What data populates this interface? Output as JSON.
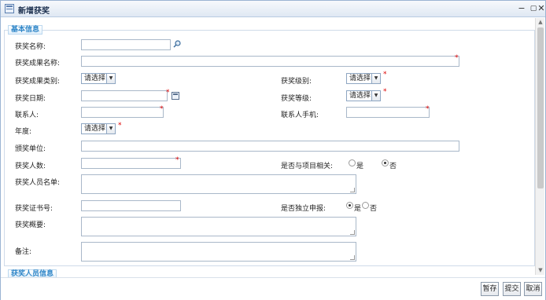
{
  "window": {
    "title": "新增获奖"
  },
  "sections": {
    "basic": "基本信息",
    "people": "获奖人员信息"
  },
  "form": {
    "award_name": "获奖名称:",
    "result_name": "获奖成果名称:",
    "result_category": "获奖成果类别:",
    "award_level": "获奖级别:",
    "award_date": "获奖日期:",
    "award_grade": "获奖等级:",
    "contact": "联系人:",
    "contact_phone": "联系人手机:",
    "year": "年度:",
    "issuer": "颁奖单位:",
    "award_count": "获奖人数:",
    "project_related": "是否与项目相关:",
    "member_list": "获奖人员名单:",
    "certificate_no": "获奖证书号:",
    "independent": "是否独立申报:",
    "summary": "获奖概要:",
    "remarks": "备注:",
    "select_placeholder": "请选择",
    "yes": "是",
    "no": "否"
  },
  "buttons": {
    "save_draft": "暂存",
    "submit": "提交",
    "cancel": "取消"
  },
  "icons": {
    "window": "form-icon",
    "search": "search-icon",
    "calendar": "calendar-icon"
  },
  "colors": {
    "section_title": "#2f86c8",
    "required": "#dd0000"
  }
}
